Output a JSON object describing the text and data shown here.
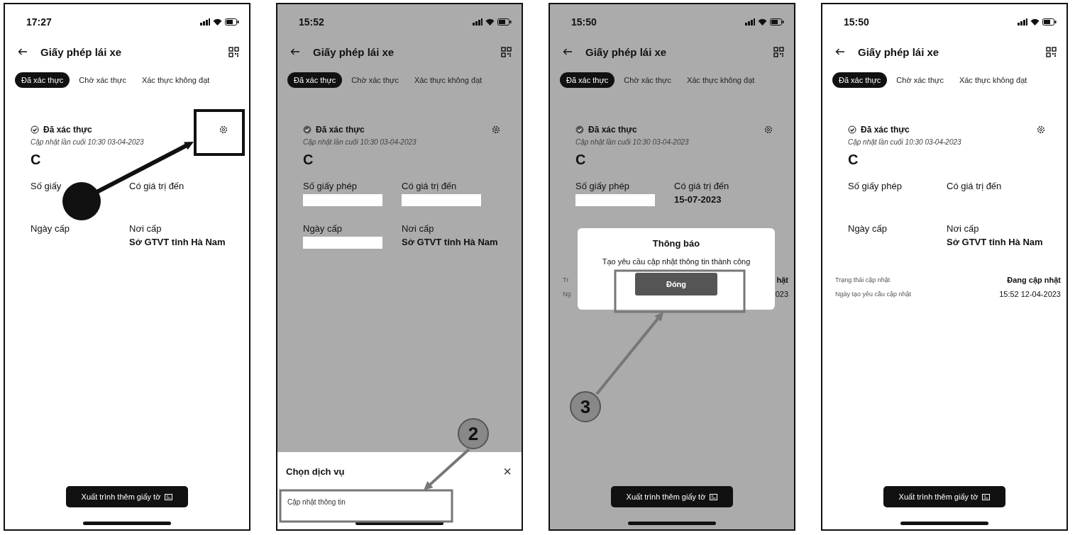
{
  "screens": [
    {
      "time": "17:27",
      "title": "Giấy phép lái xe",
      "dimmed": false,
      "tabs": [
        {
          "label": "Đã xác thực",
          "selected": true
        },
        {
          "label": "Chờ xác thực",
          "selected": false
        },
        {
          "label": "Xác thực không đạt",
          "selected": false
        }
      ],
      "status": "Đã xác thực",
      "updated": "Cập nhật lần cuối 10:30 03-04-2023",
      "license_class": "C",
      "fields": [
        {
          "label": "Số giấy",
          "kind": "empty"
        },
        {
          "label": "Có giá trị đến",
          "kind": "empty"
        },
        {
          "label": "Ngày cấp",
          "kind": "empty"
        },
        {
          "label": "Nơi cấp",
          "kind": "text",
          "value": "Sở GTVT tỉnh Hà Nam"
        }
      ],
      "bottom_button": "Xuất trình thêm giấy tờ",
      "annotation": {
        "kind": "dot_arrow"
      }
    },
    {
      "time": "15:52",
      "title": "Giấy phép lái xe",
      "dimmed": true,
      "tabs": [
        {
          "label": "Đã xác thực",
          "selected": true
        },
        {
          "label": "Chờ xác thực",
          "selected": false
        },
        {
          "label": "Xác thực không đạt",
          "selected": false
        }
      ],
      "status": "Đã xác thực",
      "updated": "Cập nhật lần cuối 10:30 03-04-2023",
      "license_class": "C",
      "fields": [
        {
          "label": "Số giấy phép",
          "kind": "redacted"
        },
        {
          "label": "Có giá trị đến",
          "kind": "redacted"
        },
        {
          "label": "Ngày cấp",
          "kind": "redacted"
        },
        {
          "label": "Nơi cấp",
          "kind": "text",
          "value": "Sở GTVT tỉnh Hà Nam"
        }
      ],
      "sheet": {
        "title": "Chọn dịch vụ",
        "close": "×",
        "option": "Cập nhật thông tin"
      },
      "annotation": {
        "kind": "numbered_arrow",
        "number": "2"
      }
    },
    {
      "time": "15:50",
      "title": "Giấy phép lái xe",
      "dimmed": true,
      "tabs": [
        {
          "label": "Đã xác thực",
          "selected": true
        },
        {
          "label": "Chờ xác thực",
          "selected": false
        },
        {
          "label": "Xác thực không đạt",
          "selected": false
        }
      ],
      "status": "Đã xác thực",
      "updated": "Cập nhật lần cuối 10:30 03-04-2023",
      "license_class": "C",
      "fields": [
        {
          "label": "Số giấy phép",
          "kind": "redacted"
        },
        {
          "label": "Có giá trị đến",
          "kind": "text",
          "value": "15-07-2023"
        }
      ],
      "update_rows": [
        {
          "label": "Tr",
          "value": "hật"
        },
        {
          "label": "Ng",
          "value": "023"
        }
      ],
      "dialog": {
        "title": "Thông báo",
        "message": "Tạo yêu cầu cập nhật thông tin thành công",
        "button": "Đóng"
      },
      "bottom_button": "Xuất trình thêm giấy tờ",
      "annotation": {
        "kind": "numbered_arrow",
        "number": "3"
      }
    },
    {
      "time": "15:50",
      "title": "Giấy phép lái xe",
      "dimmed": false,
      "tabs": [
        {
          "label": "Đã xác thực",
          "selected": true
        },
        {
          "label": "Chờ xác thực",
          "selected": false
        },
        {
          "label": "Xác thực không đạt",
          "selected": false
        }
      ],
      "status": "Đã xác thực",
      "updated": "Cập nhật lần cuối 10:30 03-04-2023",
      "license_class": "C",
      "fields": [
        {
          "label": "Số giấy phép",
          "kind": "empty"
        },
        {
          "label": "Có giá trị đến",
          "kind": "empty"
        },
        {
          "label": "Ngày cấp",
          "kind": "empty"
        },
        {
          "label": "Nơi cấp",
          "kind": "text",
          "value": "Sở GTVT tỉnh Hà Nam"
        }
      ],
      "update_rows": [
        {
          "label": "Trạng thái cập nhật",
          "value": "Đang cập nhật"
        },
        {
          "label": "Ngày tạo yêu cầu cập nhật",
          "value": "15:52 12-04-2023"
        }
      ],
      "bottom_button": "Xuất trình thêm giấy tờ"
    }
  ]
}
